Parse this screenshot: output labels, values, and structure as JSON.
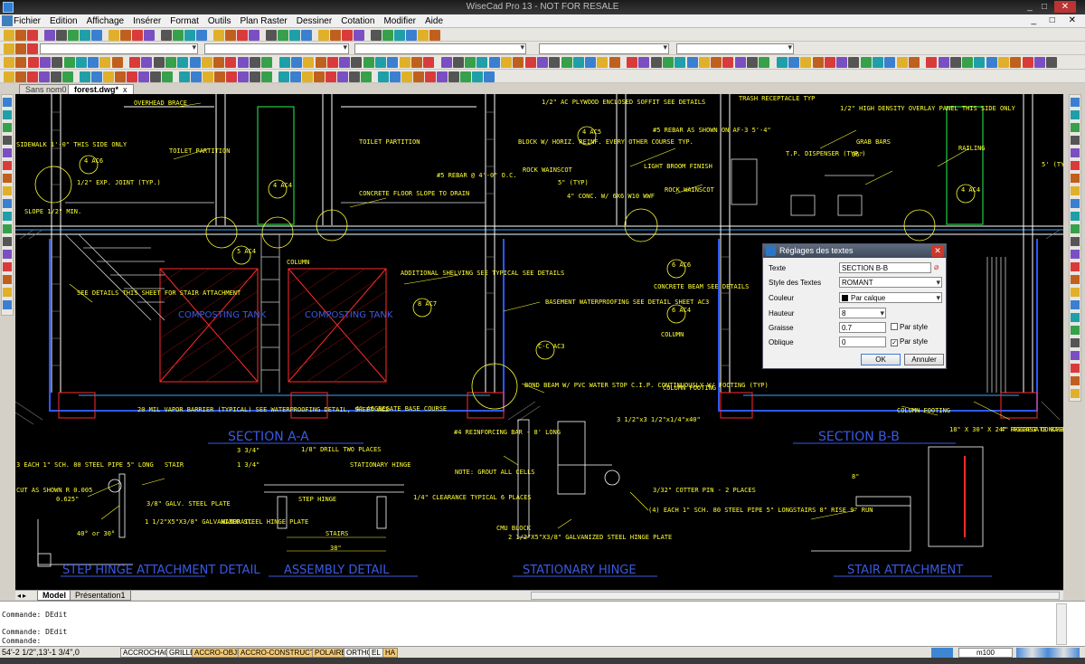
{
  "window": {
    "title": "WiseCad Pro 13 - NOT FOR RESALE",
    "controls": [
      "_",
      "□",
      "✕"
    ]
  },
  "menu": {
    "items": [
      "Fichier",
      "Edition",
      "Affichage",
      "Insérer",
      "Format",
      "Outils",
      "Plan Raster",
      "Dessiner",
      "Cotation",
      "Modifier",
      "Aide"
    ]
  },
  "doc_tabs": [
    {
      "label": "Sans nom0"
    },
    {
      "label": "forest.dwg*",
      "close": "x"
    }
  ],
  "layout_tabs": [
    "Model",
    "Présentation1"
  ],
  "command_lines": [
    "Commande: DEdit",
    "Commande: DEdit",
    "Commande:"
  ],
  "status": {
    "coords": "54'-2 1/2\",13'-1 3/4\",0",
    "modes": [
      "ACCROCHAGE",
      "GRILLE",
      "ACCRO-OBJET",
      "ACCRO-CONSTRUCTION",
      "POLAIRE",
      "ORTHO",
      "EL",
      "HA"
    ],
    "active_modes": [
      "ACCRO-OBJET",
      "ACCRO-CONSTRUCTION",
      "POLAIRE",
      "HA"
    ],
    "scale": "m100"
  },
  "dialog": {
    "title": "Réglages des textes",
    "labels": {
      "texte": "Texte",
      "style": "Style des Textes",
      "couleur": "Couleur",
      "hauteur": "Hauteur",
      "graisse": "Graisse",
      "oblique": "Oblique"
    },
    "values": {
      "texte": "SECTION B-B",
      "style": "ROMANT",
      "couleur": "Par calque",
      "hauteur": "8",
      "graisse": "0.7",
      "oblique": "0"
    },
    "checkbox_label": "Par style",
    "graisse_par_style": false,
    "oblique_par_style": true,
    "ok_label": "OK",
    "cancel_label": "Annuler"
  },
  "drawing": {
    "section_titles": [
      "SECTION A-A",
      "SECTION B-B"
    ],
    "detail_titles": [
      "STEP HINGE ATTACHMENT DETAIL",
      "ASSEMBLY DETAIL",
      "STATIONARY HINGE",
      "STAIR ATTACHMENT"
    ],
    "tank_labels": [
      "COMPOSTING TANK",
      "COMPOSTING TANK"
    ],
    "notes": [
      "OVERHEAD BRACE",
      "TOILET PARTITION",
      "SIDEWALK 1'-0\" THIS SIDE ONLY",
      "1/2\" EXP. JOINT (TYP.)",
      "CONCRETE FLOOR SLOPE TO DRAIN",
      "SLOPE 1/2\" MIN.",
      "COLUMN",
      "ADDITIONAL SHELVING SEE TYPICAL SEE DETAILS",
      "SEE DETAILS THIS SHEET FOR STAIR ATTACHMENT",
      "20 MIL VAPOR BARRIER (TYPICAL) SEE WATERPROOFING DETAIL, SHEET AC2",
      "4\" AGGREGATE BASE COURSE",
      "BOND BEAM W/ PVC WATER STOP C.I.P. CONTINUOUSLY W/ FOOTING (TYP)",
      "BASEMENT WATERPROOFING SEE DETAIL SHEET AC3",
      "1/2\" AC PLYWOOD ENCLOSED SOFFIT SEE DETAILS",
      "BLOCK W/ HORIZ. REINF. EVERY OTHER COURSE TYP.",
      "ROCK WAINSCOT",
      "#5 REBAR @ 4'-0\" O.C.",
      "5\" (TYP)",
      "4\" CONC. W/ 6X6 W10 WWF",
      "#5 REBAR AS SHOWN ON AF-3 5'-4\"",
      "LIGHT BROOM FINISH",
      "ROCK WAINSCOT",
      "TRASH RECEPTACLE TYP",
      "1/2\" HIGH DENSITY OVERLAY PANEL THIS SIDE ONLY",
      "T.P. DISPENSER (TYP.)",
      "GRAB BARS",
      "36\"",
      "RAILING",
      "5' (TYP)",
      "CONCRETE BEAM SEE DETAILS",
      "COLUMN",
      "COLUMN FOOTING",
      "COLUMN FOOTING",
      "18\" X 30\" X 24\" PRECAST CONCRETE SUMP",
      "4\" AGGREGATE BASE COURSE",
      "3 EACH 1\" SCH. 80 STEEL PIPE 5\" LONG",
      "CUT AS SHOWN R 0.005",
      "STAIR",
      "3/8\" GALV. STEEL PLATE",
      "1 1/2\"X5\"X3/8\" GALVANIZED STEEL HINGE PLATE",
      "40° or 30°",
      "0.625\"",
      "3 3/4\"",
      "1 3/4\"",
      "1/8\" DRILL TWO PLACES",
      "STATIONARY HINGE",
      "STEP HINGE",
      "HANDRAIL",
      "STAIRS",
      "38\"",
      "1/4\" CLEARANCE TYPICAL 6 PLACES",
      "#4 REINFORCING BAR - 8' LONG",
      "NOTE: GROUT ALL CELLS",
      "CMU BLOCK",
      "2 1/2\"X5\"X3/8\" GALVANIZED STEEL HINGE PLATE",
      "3 1/2\"x3 1/2\"x1/4\"x40\"",
      "3/32\" COTTER PIN - 2 PLACES",
      "(4) EACH 1\" SCH. 80 STEEL PIPE 5\" LONG",
      "STAIRS 8\" RISE 9\" RUN",
      "8\""
    ],
    "callouts": [
      "4 AC6",
      "4 AC4",
      "5 AC4",
      "4 AC5",
      "8 AC7",
      "C-C AC3",
      "6 AC6",
      "6 AC4",
      "4 AC4"
    ]
  }
}
